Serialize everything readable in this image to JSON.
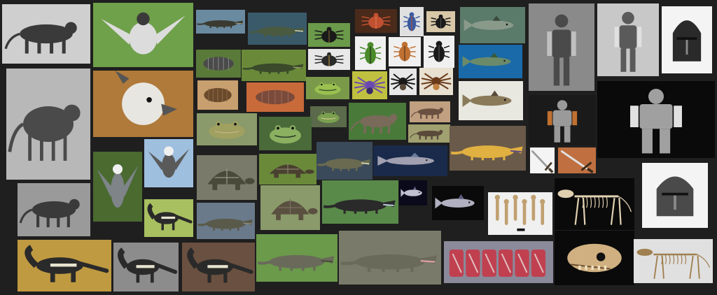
{
  "collage": {
    "background": "#1f1f1f",
    "tiles": [
      {
        "subject": "thylacine-sepia-icon",
        "bg": "#cfcfcf",
        "fg": "#3a3a3a",
        "accent": "#8a8a8a",
        "shape": "quad"
      },
      {
        "subject": "harpy-eagle-flying-icon",
        "bg": "#6fa04a",
        "fg": "#dcdcdc",
        "accent": "#3a3a3a",
        "shape": "bird"
      },
      {
        "subject": "thylacine-standing-icon",
        "bg": "#b8b8b8",
        "fg": "#4a4a4a",
        "accent": "#e0e0e0",
        "shape": "quad"
      },
      {
        "subject": "harpy-eagle-head-icon",
        "bg": "#b07a3a",
        "fg": "#e8e6e0",
        "accent": "#555",
        "shape": "head"
      },
      {
        "subject": "harpy-eagle-perched-icon",
        "bg": "#4a6a30",
        "fg": "#7e8488",
        "accent": "#f0f0f0",
        "shape": "bird"
      },
      {
        "subject": "harpy-eagle-branch-icon",
        "bg": "#9fbfdf",
        "fg": "#5a5a5a",
        "accent": "#f0f0f0",
        "shape": "bird"
      },
      {
        "subject": "thylacine-cage-icon",
        "bg": "#9a9a9a",
        "fg": "#3a3a3a",
        "accent": "#c8c8c8",
        "shape": "quad"
      },
      {
        "subject": "anteater-grass-icon",
        "bg": "#a8c060",
        "fg": "#2a2a2a",
        "accent": "#e8e4d0",
        "shape": "anteater"
      },
      {
        "subject": "anteater-walking-icon",
        "bg": "#c09a40",
        "fg": "#2a2a2a",
        "accent": "#e8e4d0",
        "shape": "anteater"
      },
      {
        "subject": "anteater-zoo-icon",
        "bg": "#8c8c8c",
        "fg": "#2a2a2a",
        "accent": "#e8e4d0",
        "shape": "anteater"
      },
      {
        "subject": "anteater-closeup-icon",
        "bg": "#6a5040",
        "fg": "#2a2a2a",
        "accent": "#e8e4d0",
        "shape": "anteater"
      },
      {
        "subject": "crocodile-swimming-icon",
        "bg": "#6a8aa0",
        "fg": "#3a3a30",
        "accent": "#a0a080",
        "shape": "reptile"
      },
      {
        "subject": "alligator-jaws-icon",
        "bg": "#3a5a6a",
        "fg": "#4a5a40",
        "accent": "#e0e0c0",
        "shape": "reptile"
      },
      {
        "subject": "stag-beetle-icon",
        "bg": "#6a9a4a",
        "fg": "#1a1a1a",
        "accent": "#8a6a3a",
        "shape": "beetle"
      },
      {
        "subject": "isopod-icon",
        "bg": "#5a7a3a",
        "fg": "#4a4a4a",
        "accent": "#8a8a8a",
        "shape": "bug"
      },
      {
        "subject": "crocodile-bank-icon",
        "bg": "#6a8a3a",
        "fg": "#3a4a2a",
        "accent": "#9a9a6a",
        "shape": "reptile"
      },
      {
        "subject": "hercules-beetle-icon",
        "bg": "#e8e8e8",
        "fg": "#2a2a2a",
        "accent": "#c8a040",
        "shape": "beetle"
      },
      {
        "subject": "woodlouse-orange-icon",
        "bg": "#c8a070",
        "fg": "#6a4a2a",
        "accent": "#8a6a4a",
        "shape": "bug"
      },
      {
        "subject": "woodlouse-pink-icon",
        "bg": "#c86a3a",
        "fg": "#7a4a3a",
        "accent": "#a06a5a",
        "shape": "bug"
      },
      {
        "subject": "frog-green-icon",
        "bg": "#7a9a4a",
        "fg": "#9ac050",
        "accent": "#3a5a2a",
        "shape": "frog"
      },
      {
        "subject": "frog-horned-icon",
        "bg": "#5a6a4a",
        "fg": "#7aa050",
        "accent": "#c0c080",
        "shape": "frog"
      },
      {
        "subject": "bullfrog-icon",
        "bg": "#8a9a6a",
        "fg": "#a0a060",
        "accent": "#c0b080",
        "shape": "frog"
      },
      {
        "subject": "frog-puddle-icon",
        "bg": "#4a6a3a",
        "fg": "#8ab060",
        "accent": "#2a3a2a",
        "shape": "frog"
      },
      {
        "subject": "beetle-group-icon",
        "bg": "#4a2a1a",
        "fg": "#c05030",
        "accent": "#e08050",
        "shape": "beetle"
      },
      {
        "subject": "beetle-blue-icon",
        "bg": "#e0e0e0",
        "fg": "#3a5aa0",
        "accent": "#c05030",
        "shape": "beetle"
      },
      {
        "subject": "dung-beetle-icon",
        "bg": "#d8c8a8",
        "fg": "#1a1a1a",
        "accent": "#4a4a4a",
        "shape": "beetle"
      },
      {
        "subject": "green-beetle-icon",
        "bg": "#f0f0f0",
        "fg": "#4a8a2a",
        "accent": "#1a1a1a",
        "shape": "beetle"
      },
      {
        "subject": "orange-beetle-icon",
        "bg": "#f0f0f0",
        "fg": "#c07030",
        "accent": "#3a2a1a",
        "shape": "beetle"
      },
      {
        "subject": "black-beetle-icon",
        "bg": "#f0f0f0",
        "fg": "#1a1a1a",
        "accent": "#5a5a5a",
        "shape": "beetle"
      },
      {
        "subject": "purple-spider-icon",
        "bg": "#c0c040",
        "fg": "#6a4ab0",
        "accent": "#3a2a6a",
        "shape": "spider"
      },
      {
        "subject": "tarantula-dark-icon",
        "bg": "#e8e8e8",
        "fg": "#1a1a1a",
        "accent": "#5a4a3a",
        "shape": "spider"
      },
      {
        "subject": "tarantula-orange-icon",
        "bg": "#e8e0d0",
        "fg": "#6a3a1a",
        "accent": "#c08040",
        "shape": "spider"
      },
      {
        "subject": "pangolin-icon",
        "bg": "#4a7a3a",
        "fg": "#7a6a5a",
        "accent": "#a09080",
        "shape": "quad"
      },
      {
        "subject": "pangolin-walking-icon",
        "bg": "#c0a080",
        "fg": "#6a5040",
        "accent": "#4a3a2a",
        "shape": "quad"
      },
      {
        "subject": "pangolin-grass-icon",
        "bg": "#a0a070",
        "fg": "#5a4a3a",
        "accent": "#3a2a1a",
        "shape": "quad"
      },
      {
        "subject": "tortoise-rocks-icon",
        "bg": "#7a7a6a",
        "fg": "#4a4a3a",
        "accent": "#9a9a8a",
        "shape": "tortoise"
      },
      {
        "subject": "tortoise-grass-icon",
        "bg": "#6a8a3a",
        "fg": "#4a4030",
        "accent": "#8a8070",
        "shape": "tortoise"
      },
      {
        "subject": "tortoise-giant-icon",
        "bg": "#8a9a6a",
        "fg": "#5a5040",
        "accent": "#7a7060",
        "shape": "tortoise"
      },
      {
        "subject": "komodo-dragon-icon",
        "bg": "#6a7a8a",
        "fg": "#5a5a4a",
        "accent": "#8a8a7a",
        "shape": "reptile"
      },
      {
        "subject": "crocodile-jaws-icon",
        "bg": "#3a4a5a",
        "fg": "#6a6a50",
        "accent": "#e0e0c0",
        "shape": "reptile"
      },
      {
        "subject": "shark-deep-icon",
        "bg": "#1a2a4a",
        "fg": "#a0a0b0",
        "accent": "#6a7a9a",
        "shape": "fish"
      },
      {
        "subject": "gecko-icon",
        "bg": "#6a5a4a",
        "fg": "#e0b040",
        "accent": "#5a4a8a",
        "shape": "reptile"
      },
      {
        "subject": "komodo-hills-icon",
        "bg": "#5a8a4a",
        "fg": "#2a2a2a",
        "accent": "#c0d0e0",
        "shape": "reptile"
      },
      {
        "subject": "komodo-walking-icon",
        "bg": "#6a9a4a",
        "fg": "#6a6a5a",
        "accent": "#4a4a3a",
        "shape": "reptile"
      },
      {
        "subject": "komodo-roaring-icon",
        "bg": "#7a7a6a",
        "fg": "#6a6a5a",
        "accent": "#e0a0a0",
        "shape": "reptile"
      },
      {
        "subject": "goblin-shark-icon",
        "bg": "#0a0a1a",
        "fg": "#c0c0d0",
        "accent": "#6a6a8a",
        "shape": "fish"
      },
      {
        "subject": "goblin-shark-side-icon",
        "bg": "#0a0a0a",
        "fg": "#b0b0c0",
        "accent": "#5a5a7a",
        "shape": "fish"
      },
      {
        "subject": "fish-underwater-icon",
        "bg": "#5a7a6a",
        "fg": "#8a9a8a",
        "accent": "#3a4a3a",
        "shape": "fish"
      },
      {
        "subject": "gar-fish-blue-icon",
        "bg": "#1a6aaa",
        "fg": "#6a8a6a",
        "accent": "#3a5a3a",
        "shape": "fish"
      },
      {
        "subject": "gar-fish-specimens-icon",
        "bg": "#e8e8e0",
        "fg": "#8a7a5a",
        "accent": "#5a4a3a",
        "shape": "fish"
      },
      {
        "subject": "armor-suit-gallery-icon",
        "bg": "#8a8a8a",
        "fg": "#4a4a4a",
        "accent": "#c0c0c0",
        "shape": "armor"
      },
      {
        "subject": "armor-cuirass-icon",
        "bg": "#c8c8c8",
        "fg": "#5a5a5a",
        "accent": "#e0e0e0",
        "shape": "armor"
      },
      {
        "subject": "armor-helmet-icon",
        "bg": "#f4f4f4",
        "fg": "#2a2a2a",
        "accent": "#8a8a8a",
        "shape": "helmet"
      },
      {
        "subject": "armor-trio-icon",
        "bg": "#1a1a1a",
        "fg": "#9a9a9a",
        "accent": "#c07030",
        "shape": "armor"
      },
      {
        "subject": "armor-pair-icon",
        "bg": "#0a0a0a",
        "fg": "#a0a0a0",
        "accent": "#e0e0e0",
        "shape": "armor"
      },
      {
        "subject": "sword-icon",
        "bg": "#f4f4f4",
        "fg": "#9a9a9a",
        "accent": "#4a3a2a",
        "shape": "sword"
      },
      {
        "subject": "sword-brown-icon",
        "bg": "#c07040",
        "fg": "#e0e0e0",
        "accent": "#3a2a1a",
        "shape": "sword"
      },
      {
        "subject": "great-helm-icon",
        "bg": "#f4f4f4",
        "fg": "#4a4a4a",
        "accent": "#8a8a8a",
        "shape": "helmet"
      },
      {
        "subject": "skeleton-black-icon",
        "bg": "#0a0a0a",
        "fg": "#e0d0b0",
        "accent": "#8a7a5a",
        "shape": "skeleton"
      },
      {
        "subject": "bones-specimens-icon",
        "bg": "#f0f0f0",
        "fg": "#c0a070",
        "accent": "#8a6a4a",
        "shape": "bones"
      },
      {
        "subject": "skull-icon",
        "bg": "#0a0a0a",
        "fg": "#d0b080",
        "accent": "#6a5030",
        "shape": "skull"
      },
      {
        "subject": "skeleton-museum-icon",
        "bg": "#e0e0e0",
        "fg": "#a08050",
        "accent": "#5a4030",
        "shape": "skeleton"
      },
      {
        "subject": "meat-cuts-icon",
        "bg": "#8a8a9a",
        "fg": "#c04050",
        "accent": "#e0c0c0",
        "shape": "meat"
      }
    ]
  }
}
